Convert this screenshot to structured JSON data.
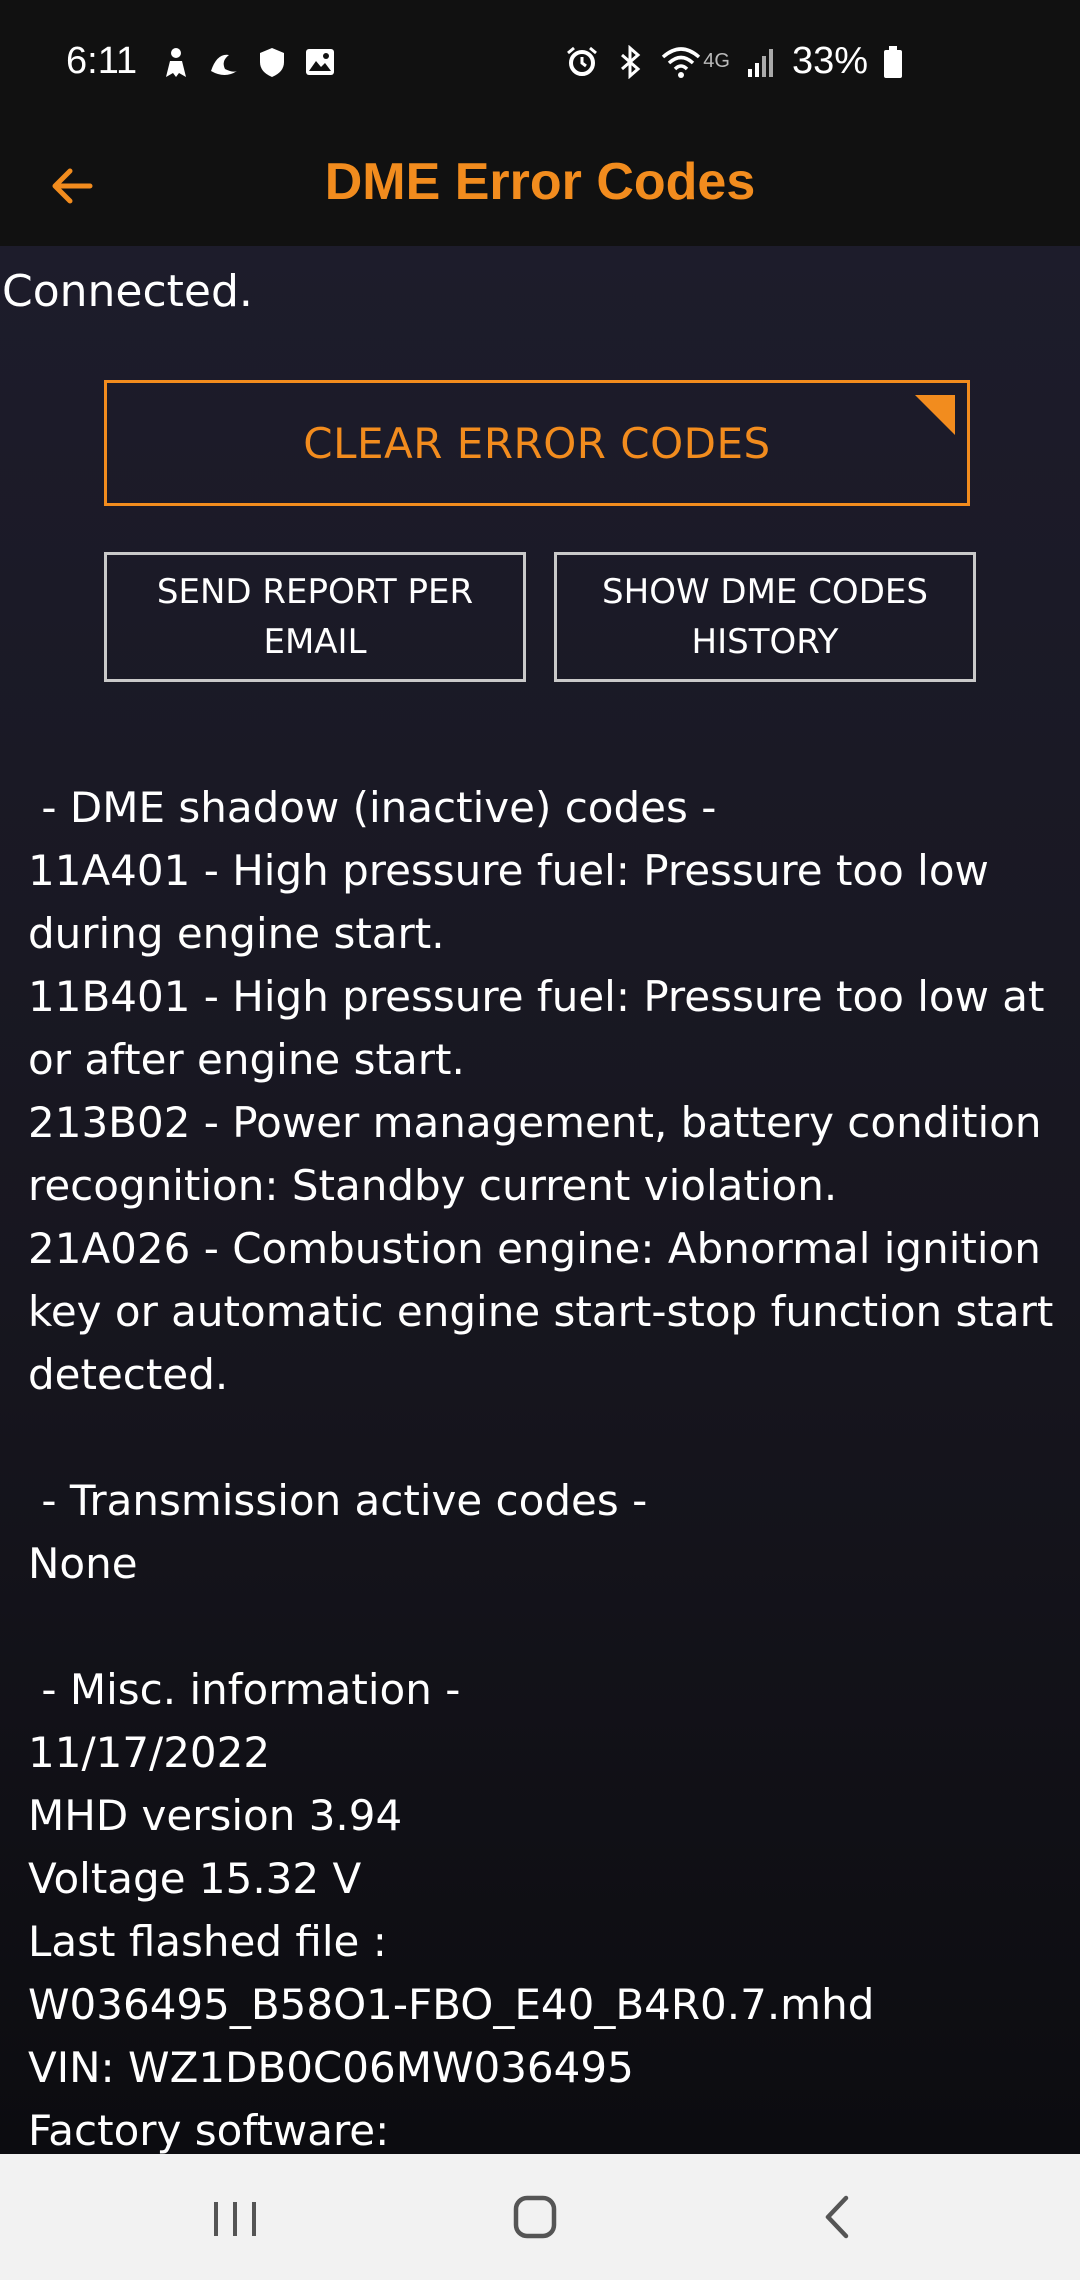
{
  "status_bar": {
    "time": "6:11",
    "battery_percent": "33%",
    "network": "4G",
    "left_icons": [
      "person-icon",
      "moon-icon",
      "shield-icon",
      "gallery-icon"
    ],
    "right_icons": [
      "alarm-icon",
      "bluetooth-icon",
      "wifi-icon",
      "signal-icon",
      "battery-icon"
    ]
  },
  "app_bar": {
    "title": "DME Error Codes",
    "back_icon": "arrow-left-icon"
  },
  "status_text": "Connected.",
  "buttons": {
    "clear": "CLEAR ERROR CODES",
    "send_report": "SEND REPORT PER EMAIL",
    "history": "SHOW DME CODES HISTORY"
  },
  "report_lines": [
    " - DME shadow (inactive) codes -",
    "11A401 - High pressure fuel: Pressure too low during engine start.",
    "11B401 - High pressure fuel: Pressure too low at or after engine start.",
    "213B02 - Power management, battery condition recognition: Standby current violation.",
    "21A026 - Combustion engine: Abnormal ignition key or automatic engine start-stop function start detected.",
    "",
    " - Transmission active codes -",
    "None",
    "",
    " - Misc. information -",
    "11/17/2022",
    "MHD version 3.94",
    "Voltage 15.32 V",
    "Last flashed file :",
    "W036495_B58O1-FBO_E40_B4R0.7.mhd",
    "VIN: WZ1DB0C06MW036495",
    "Factory software:"
  ],
  "colors": {
    "accent": "#F28C1E",
    "bar_background": "#111111",
    "content_background": "#1d1c2b",
    "nav_background": "#f2f2f2"
  },
  "nav_bar": {
    "icons": [
      "recents-icon",
      "home-icon",
      "back-icon"
    ]
  }
}
